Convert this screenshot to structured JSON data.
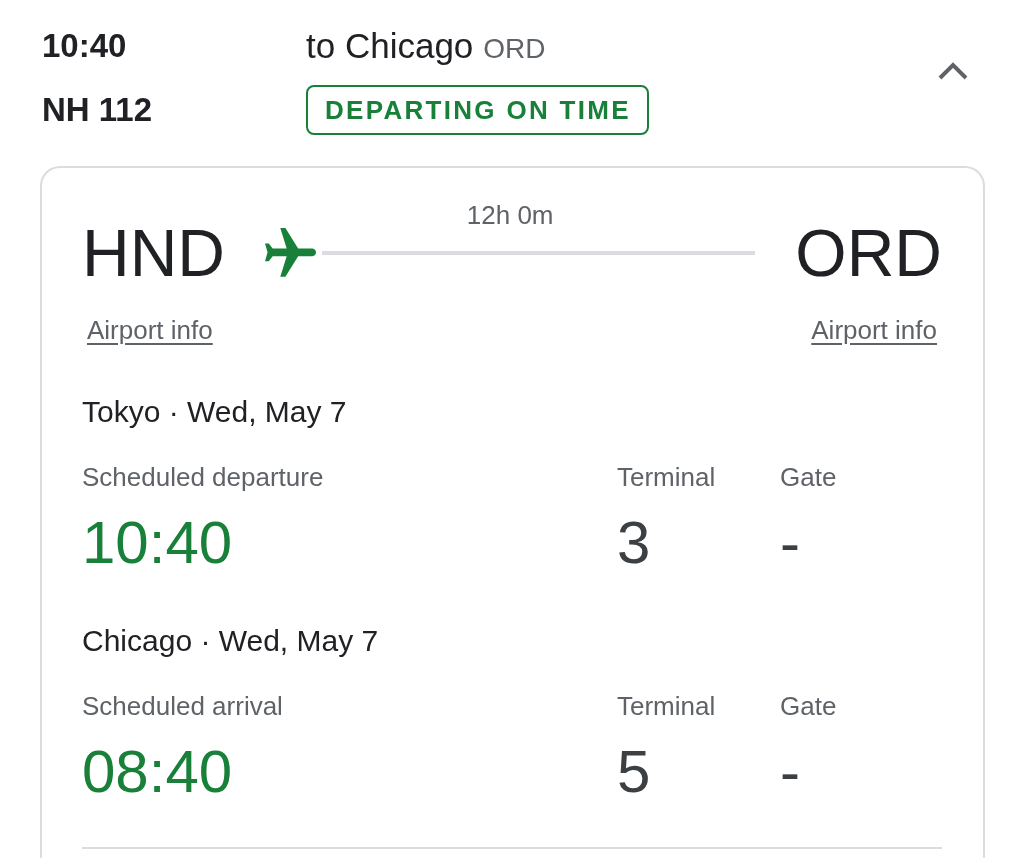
{
  "flight": {
    "departure_time": "10:40",
    "number": "NH 112",
    "destination": "to Chicago",
    "destination_code": "ORD",
    "status": {
      "label": "DEPARTING ON TIME",
      "kind": "on_time"
    },
    "expanded": true
  },
  "route": {
    "origin": {
      "code": "HND",
      "link": "Airport info"
    },
    "duration": "12h 0m",
    "level": 0,
    "destination": {
      "code": "ORD",
      "link": "Airport info"
    }
  },
  "legs": [
    {
      "heading": "Tokyo · Wed, May 7",
      "time_label": "Scheduled departure",
      "time": "10:40",
      "terminal_label": "Terminal",
      "terminal": "3",
      "gate_label": "Gate",
      "gate": "-"
    },
    {
      "heading": "Chicago · Wed, May 7",
      "time_label": "Scheduled arrival",
      "time": "08:40",
      "terminal_label": "Terminal",
      "terminal": "5",
      "gate_label": "Gate",
      "gate": "-"
    }
  ]
}
